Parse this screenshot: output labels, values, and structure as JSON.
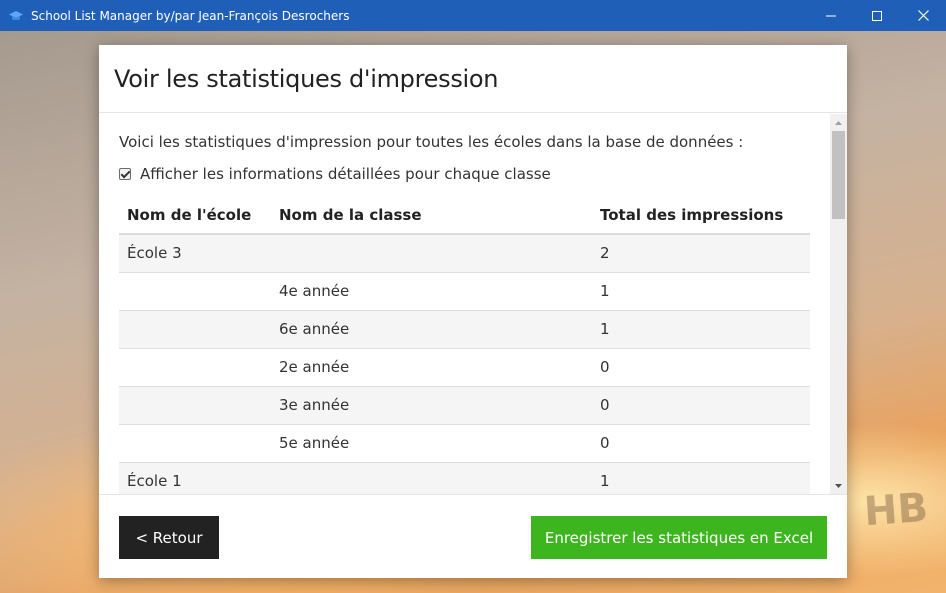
{
  "window": {
    "title": "School List Manager by/par Jean-François Desrochers",
    "controls": [
      "minimize-icon",
      "maximize-icon",
      "close-icon"
    ]
  },
  "dialog": {
    "title": "Voir les statistiques d'impression",
    "intro": "Voici les statistiques d'impression pour toutes les écoles dans la base de données :",
    "checkbox_label": "Afficher les informations détaillées pour chaque classe",
    "checkbox_checked": true
  },
  "table": {
    "headers": [
      "Nom de l'école",
      "Nom de la classe",
      "Total des impressions"
    ],
    "rows": [
      [
        "École 3",
        "",
        "2"
      ],
      [
        "",
        "4e année",
        "1"
      ],
      [
        "",
        "6e année",
        "1"
      ],
      [
        "",
        "2e année",
        "0"
      ],
      [
        "",
        "3e année",
        "0"
      ],
      [
        "",
        "5e année",
        "0"
      ],
      [
        "École 1",
        "",
        "1"
      ]
    ]
  },
  "buttons": {
    "back_label": "< Retour",
    "excel_label": "Enregistrer les statistiques en Excel"
  },
  "colors": {
    "titlebar": "#1f5fb8",
    "back_button": "#222222",
    "excel_button": "#3db51f"
  },
  "background_text": "HB"
}
